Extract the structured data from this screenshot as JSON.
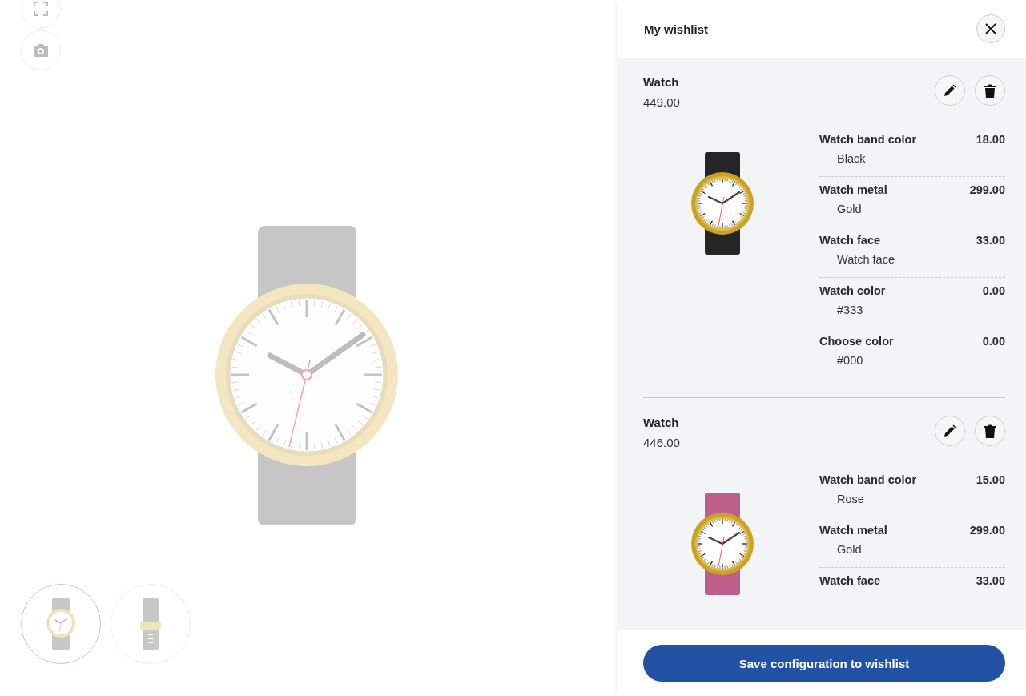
{
  "viewer": {
    "tools": [
      {
        "kind": "fullscreen"
      },
      {
        "kind": "camera"
      }
    ],
    "thumbnails": [
      {
        "kind": "front",
        "selected": true
      },
      {
        "kind": "side",
        "selected": false
      }
    ]
  },
  "wishlist": {
    "title": "My wishlist",
    "items": [
      {
        "name": "Watch",
        "price": "449.00",
        "color": "#252525",
        "options": [
          {
            "name": "Watch band color",
            "price": "18.00",
            "value": "Black"
          },
          {
            "name": "Watch metal",
            "price": "299.00",
            "value": "Gold"
          },
          {
            "name": "Watch face",
            "price": "33.00",
            "value": "Watch face"
          },
          {
            "name": "Watch color",
            "price": "0.00",
            "value": "#333"
          },
          {
            "name": "Choose color",
            "price": "0.00",
            "value": "#000"
          }
        ]
      },
      {
        "name": "Watch",
        "price": "446.00",
        "color": "#bc608b",
        "options": [
          {
            "name": "Watch band color",
            "price": "15.00",
            "value": "Rose"
          },
          {
            "name": "Watch metal",
            "price": "299.00",
            "value": "Gold"
          },
          {
            "name": "Watch face",
            "price": "33.00"
          }
        ]
      }
    ],
    "save_button": "Save configuration to wishlist"
  }
}
